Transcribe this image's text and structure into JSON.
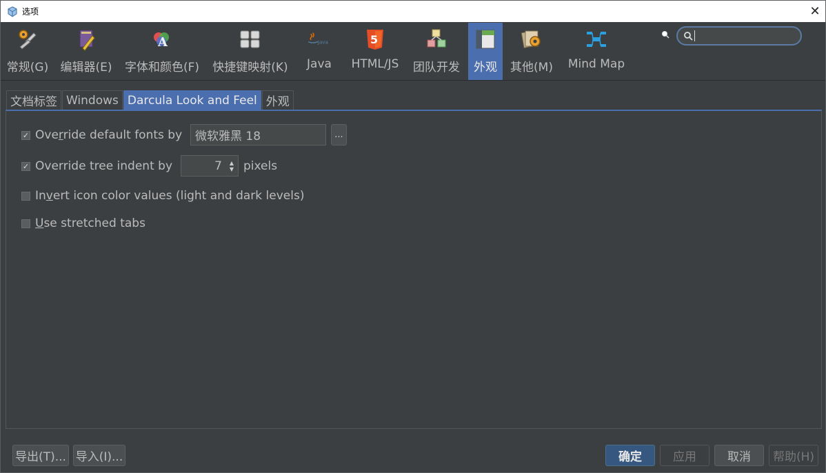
{
  "window": {
    "title": "选项"
  },
  "toolbar": {
    "items": [
      {
        "label": "常规(G)",
        "icon": "wrench-gear-icon"
      },
      {
        "label": "编辑器(E)",
        "icon": "editor-pencil-icon"
      },
      {
        "label": "字体和颜色(F)",
        "icon": "font-color-icon"
      },
      {
        "label": "快捷键映射(K)",
        "icon": "keyboard-icon"
      },
      {
        "label": "Java",
        "icon": "java-icon"
      },
      {
        "label": "HTML/JS",
        "icon": "html5-icon"
      },
      {
        "label": "团队开发",
        "icon": "team-cubes-icon"
      },
      {
        "label": "外观",
        "icon": "appearance-icon"
      },
      {
        "label": "其他(M)",
        "icon": "misc-gear-icon"
      },
      {
        "label": "Mind Map",
        "icon": "mindmap-icon"
      }
    ],
    "active_index": 7,
    "search": {
      "value": "",
      "placeholder": ""
    }
  },
  "tabs": [
    "文档标签",
    "Windows",
    "Darcula Look and Feel",
    "外观"
  ],
  "active_tab": 2,
  "options": {
    "override_fonts": {
      "label_pre": "Ove",
      "label_u": "r",
      "label_post": "ride default fonts by",
      "checked": true,
      "font_value": "微软雅黑 18",
      "browse_label": "..."
    },
    "override_indent": {
      "label": "Override tree indent by",
      "checked": true,
      "value": "7",
      "suffix": "pixels"
    },
    "invert_icons": {
      "label_pre": "In",
      "label_u": "v",
      "label_post": "ert icon color values (light and dark levels)",
      "checked": false
    },
    "stretched_tabs": {
      "label_u": "U",
      "label_post": "se stretched tabs",
      "checked": false
    }
  },
  "buttons": {
    "export": "导出(T)...",
    "import": "导入(I)...",
    "ok": "确定",
    "apply": "应用",
    "cancel": "取消",
    "help": "帮助(H)"
  },
  "colors": {
    "accent": "#4b6eaf",
    "background": "#3c3f41",
    "text": "#bbbbbb",
    "primary_button": "#365880"
  }
}
